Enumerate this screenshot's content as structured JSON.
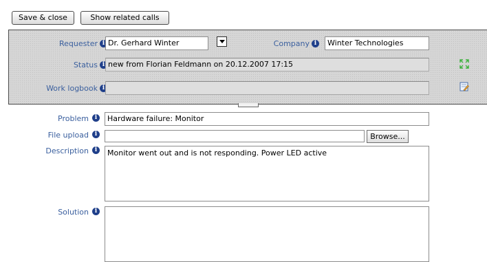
{
  "toolbar": {
    "save_close_label": "Save & close",
    "related_calls_label": "Show related calls"
  },
  "header_panel": {
    "requester": {
      "label": "Requester",
      "value": "Dr. Gerhard Winter"
    },
    "company": {
      "label": "Company",
      "value": "Winter Technologies"
    },
    "status": {
      "label": "Status",
      "value": "new from Florian Feldmann on 20.12.2007 17:15"
    },
    "work_logbook": {
      "label": "Work logbook",
      "value": ""
    }
  },
  "form": {
    "problem": {
      "label": "Problem",
      "value": "Hardware failure: Monitor"
    },
    "file_upload": {
      "label": "File upload",
      "value": "",
      "browse_label": "Browse..."
    },
    "description": {
      "label": "Description",
      "value": "Monitor went out and is not responding. Power LED active"
    },
    "solution": {
      "label": "Solution",
      "value": ""
    }
  },
  "info_icon_glyph": "i",
  "colors": {
    "label_blue": "#3a5f9e",
    "info_icon": "#1f3f8a",
    "panel_bg": "#d6d6d6",
    "readonly_field": "#dedede",
    "expand_icon": "#3bb03b"
  }
}
